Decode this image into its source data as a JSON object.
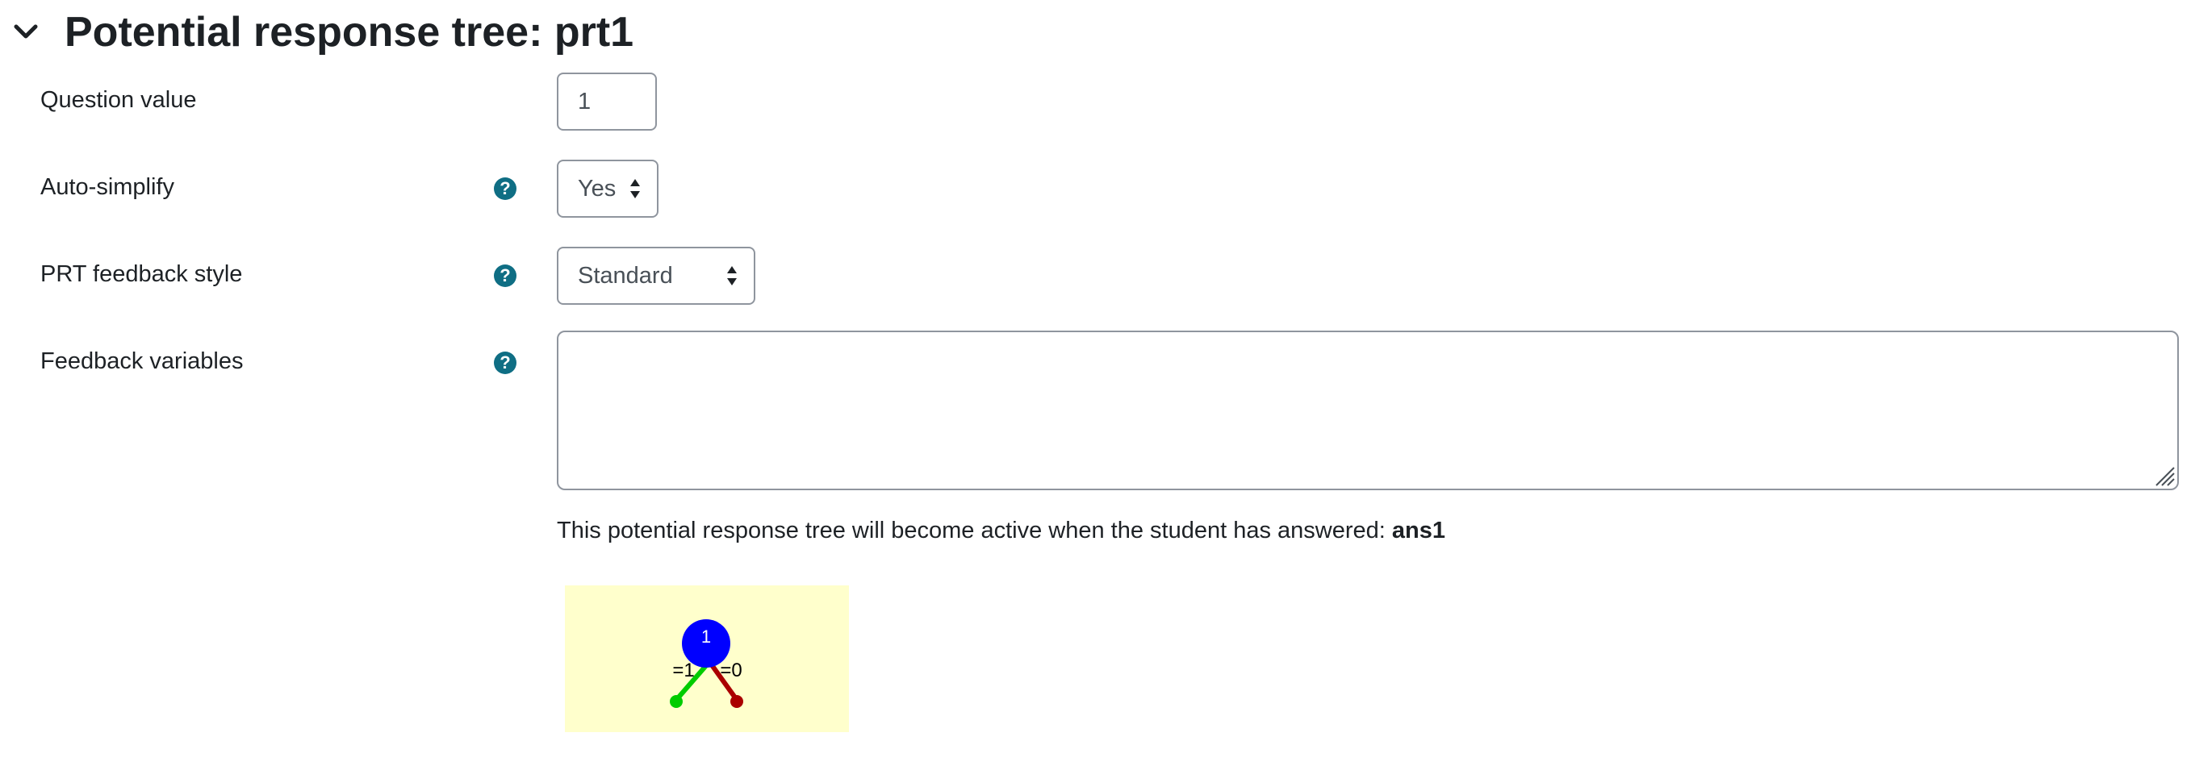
{
  "section": {
    "title": "Potential response tree: prt1",
    "toggle_icon": "chevron-down-icon"
  },
  "fields": {
    "question_value": {
      "label": "Question value",
      "value": "1"
    },
    "auto_simplify": {
      "label": "Auto-simplify",
      "selected": "Yes",
      "help_icon": "question-circle-icon"
    },
    "feedback_style": {
      "label": "PRT feedback style",
      "selected": "Standard",
      "help_icon": "question-circle-icon"
    },
    "feedback_variables": {
      "label": "Feedback variables",
      "value": "",
      "help_icon": "question-circle-icon"
    }
  },
  "active_note": {
    "text": "This potential response tree will become active when the student has answered: ",
    "answer": "ans1"
  },
  "tree": {
    "background": "#ffffcc",
    "node": {
      "label": "1",
      "color": "#0000ff"
    },
    "true_branch": {
      "label": "=1",
      "color": "#00cc00"
    },
    "false_branch": {
      "label": "=0",
      "color": "#aa0000"
    }
  },
  "colors": {
    "help_icon": "#0f6e84",
    "text": "#1d2125",
    "input_border": "#8f959e"
  }
}
